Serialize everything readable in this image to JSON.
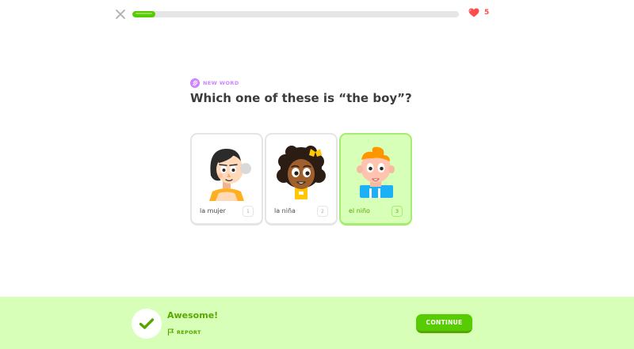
{
  "header": {
    "close_icon": "close-icon",
    "progress_fraction": 0.07,
    "hearts": {
      "icon": "heart-icon",
      "count": "5",
      "color": "#ff4b4b"
    }
  },
  "challenge": {
    "tag_icon": "new-word-icon",
    "tag_label": "NEW WORD",
    "question": "Which one of these is “the boy”?"
  },
  "choices": [
    {
      "label": "la mujer",
      "key": "1",
      "image": "woman-character",
      "selected": false
    },
    {
      "label": "la niña",
      "key": "2",
      "image": "girl-character",
      "selected": false
    },
    {
      "label": "el niño",
      "key": "3",
      "image": "boy-character",
      "selected": true
    }
  ],
  "footer": {
    "status_icon": "checkmark-icon",
    "feedback_title": "Awesome!",
    "report_icon": "flag-icon",
    "report_label": "REPORT",
    "continue_label": "CONTINUE"
  },
  "colors": {
    "accent_green": "#58cc02",
    "success_bg": "#d7ffb8",
    "success_text": "#58a700",
    "tag_purple": "#ce82ff"
  }
}
